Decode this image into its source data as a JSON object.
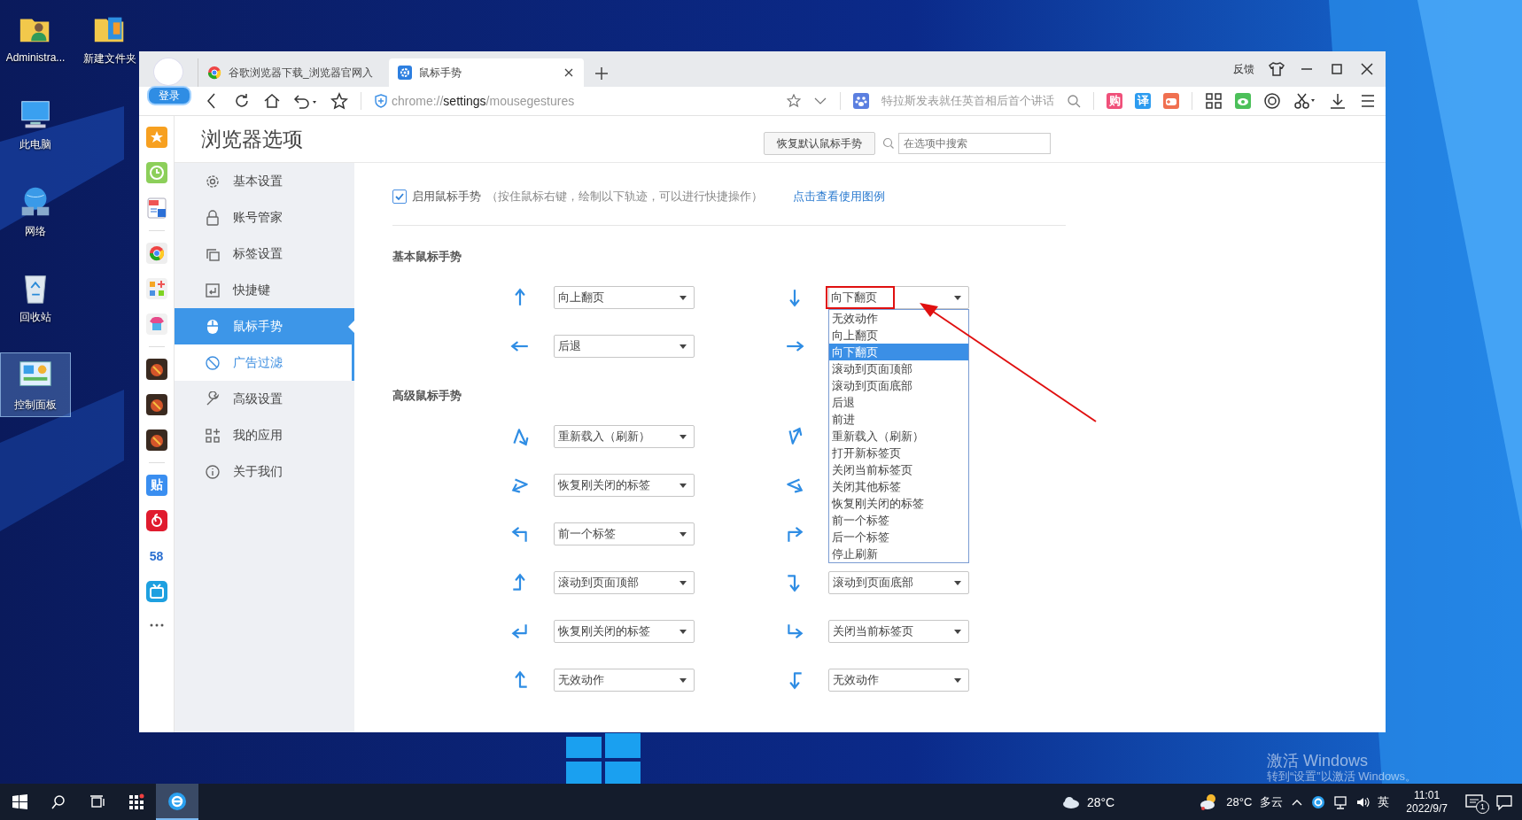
{
  "desktop_icons": [
    {
      "label": "Administra...",
      "kind": "user-folder",
      "selected": false
    },
    {
      "label": "新建文件夹",
      "kind": "folder",
      "selected": false
    },
    {
      "label": "此电脑",
      "kind": "computer",
      "selected": false
    },
    {
      "label": "网络",
      "kind": "network",
      "selected": false
    },
    {
      "label": "回收站",
      "kind": "recycle-bin",
      "selected": false
    },
    {
      "label": "控制面板",
      "kind": "control-panel",
      "selected": true
    }
  ],
  "activation": {
    "title": "激活 Windows",
    "hint": "转到“设置”以激活 Windows。"
  },
  "browser": {
    "login": "登录",
    "tabs": [
      {
        "title": "谷歌浏览器下载_浏览器官网入",
        "kind": "chrome",
        "selected": false
      },
      {
        "title": "鼠标手势",
        "kind": "settings",
        "selected": true
      }
    ],
    "feedback": "反馈",
    "address": {
      "scheme": "chrome://",
      "host": "settings",
      "path": "/mousegestures"
    },
    "news": "特拉斯发表就任英首相后首个讲话",
    "tool_badges": [
      {
        "glyph": "购"
      },
      {
        "glyph": "译"
      }
    ],
    "rail": [
      {
        "kind": "star"
      },
      {
        "kind": "clock"
      },
      {
        "kind": "pdf"
      },
      {
        "kind": "separator"
      },
      {
        "kind": "chrome"
      },
      {
        "kind": "apps"
      },
      {
        "kind": "shirt"
      },
      {
        "kind": "separator"
      },
      {
        "kind": "game"
      },
      {
        "kind": "game"
      },
      {
        "kind": "game"
      },
      {
        "kind": "separator"
      },
      {
        "kind": "glyph",
        "glyph": "贴"
      },
      {
        "kind": "music"
      },
      {
        "kind": "glyph",
        "glyph": "58"
      },
      {
        "kind": "tv"
      },
      {
        "kind": "more"
      }
    ]
  },
  "settings": {
    "title": "浏览器选项",
    "restore_button": "恢复默认鼠标手势",
    "search": {
      "placeholder": "在选项中搜索"
    },
    "sidebar": [
      {
        "label": "基本设置",
        "selected": false,
        "hovered": false
      },
      {
        "label": "账号管家",
        "selected": false,
        "hovered": false
      },
      {
        "label": "标签设置",
        "selected": false,
        "hovered": false
      },
      {
        "label": "快捷键",
        "selected": false,
        "hovered": false
      },
      {
        "label": "鼠标手势",
        "selected": true,
        "hovered": false
      },
      {
        "label": "广告过滤",
        "selected": false,
        "hovered": true
      },
      {
        "label": "高级设置",
        "selected": false,
        "hovered": false
      },
      {
        "label": "我的应用",
        "selected": false,
        "hovered": false
      },
      {
        "label": "关于我们",
        "selected": false,
        "hovered": false
      }
    ],
    "enable": {
      "label": "启用鼠标手势",
      "hint": "（按住鼠标右键，绘制以下轨迹，可以进行快捷操作）",
      "checked": true,
      "link": "点击查看使用图例"
    },
    "sections": [
      {
        "title": "基本鼠标手势",
        "rows": [
          {
            "left": {
              "kind": "up",
              "value": "向上翻页"
            },
            "right": {
              "kind": "down",
              "value": "向下翻页",
              "open": true,
              "highlighted": true,
              "options": [
                {
                  "label": "无效动作",
                  "selected": false
                },
                {
                  "label": "向上翻页",
                  "selected": false
                },
                {
                  "label": "向下翻页",
                  "selected": true
                },
                {
                  "label": "滚动到页面顶部",
                  "selected": false
                },
                {
                  "label": "滚动到页面底部",
                  "selected": false
                },
                {
                  "label": "后退",
                  "selected": false
                },
                {
                  "label": "前进",
                  "selected": false
                },
                {
                  "label": "重新载入（刷新）",
                  "selected": false
                },
                {
                  "label": "打开新标签页",
                  "selected": false
                },
                {
                  "label": "关闭当前标签页",
                  "selected": false
                },
                {
                  "label": "关闭其他标签",
                  "selected": false
                },
                {
                  "label": "恢复刚关闭的标签",
                  "selected": false
                },
                {
                  "label": "前一个标签",
                  "selected": false
                },
                {
                  "label": "后一个标签",
                  "selected": false
                },
                {
                  "label": "停止刷新",
                  "selected": false
                }
              ]
            }
          },
          {
            "left": {
              "kind": "left",
              "value": "后退"
            },
            "right": {
              "kind": "right"
            }
          }
        ]
      },
      {
        "title": "高级鼠标手势",
        "rows": [
          {
            "left": {
              "kind": "zigzag-down",
              "value": "重新载入（刷新）"
            },
            "right": {
              "kind": "zigzag-up"
            }
          },
          {
            "left": {
              "kind": "zigzag-left",
              "value": "恢复刚关闭的标签"
            },
            "right": {
              "kind": "zigzag-right"
            }
          },
          {
            "left": {
              "kind": "up-left",
              "value": "前一个标签"
            },
            "right": {
              "kind": "up-right"
            }
          },
          {
            "left": {
              "kind": "hook-up",
              "value": "滚动到页面顶部"
            },
            "right": {
              "kind": "hook-down",
              "value": "滚动到页面底部"
            }
          },
          {
            "left": {
              "kind": "down-left",
              "value": "恢复刚关闭的标签"
            },
            "right": {
              "kind": "down-right",
              "value": "关闭当前标签页"
            }
          },
          {
            "left": {
              "kind": "corner-up",
              "value": "无效动作"
            },
            "right": {
              "kind": "corner-down",
              "value": "无效动作"
            }
          }
        ]
      }
    ]
  },
  "taskbar": {
    "weather_temp": "28°C",
    "tray_temp": "28°C",
    "tray_weather": "多云",
    "ime": "英",
    "time": "11:01",
    "date": "2022/9/7",
    "notifications": "1"
  }
}
